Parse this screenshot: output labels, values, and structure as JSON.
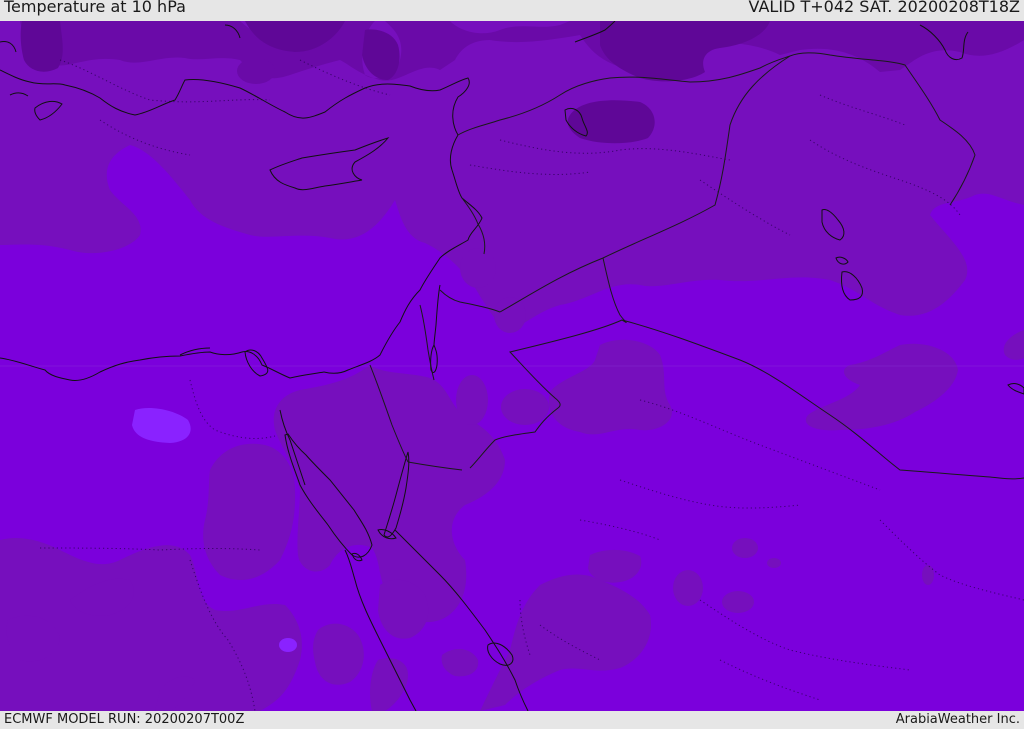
{
  "header": {
    "title": "Temperature at 10 hPa",
    "valid": "VALID T+042 SAT. 20200208T18Z"
  },
  "footer": {
    "model_run": "ECMWF MODEL RUN: 20200207T00Z",
    "credit": "ArabiaWeather Inc."
  },
  "colors": {
    "base": "#7b00dc",
    "band_warm": "#760fbd",
    "band_dark": "#6a0aa8",
    "band_darkest": "#5f0797",
    "cold_spot": "#8a22ff",
    "coastline": "#111111",
    "border": "#1a1a1a"
  }
}
